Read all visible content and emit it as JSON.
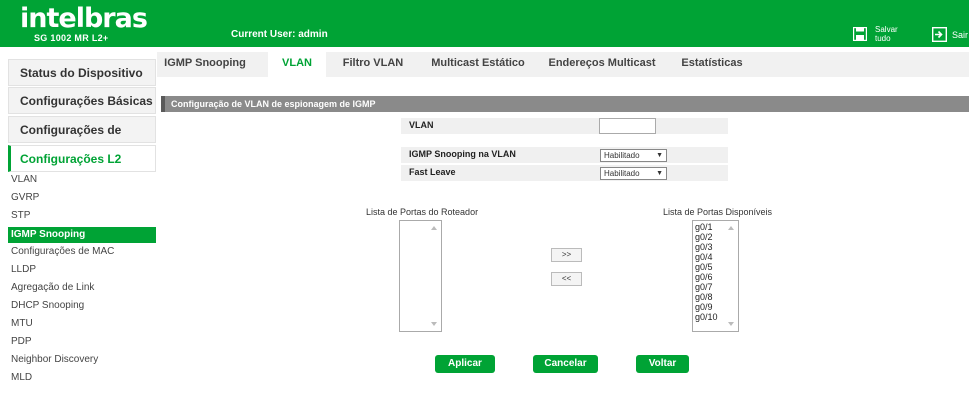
{
  "header": {
    "logo": "intelbras",
    "model": "SG 1002 MR L2+",
    "current_user": "Current User: admin",
    "save_label": "Salvar\ntudo",
    "exit_label": "Sair"
  },
  "sidebar": {
    "main_items": [
      {
        "label": "Status do Dispositivo"
      },
      {
        "label": "Configurações Básicas"
      },
      {
        "label": "Configurações de Portas"
      }
    ],
    "active_section": "Configurações L2",
    "sub_items": [
      {
        "label": "VLAN"
      },
      {
        "label": "GVRP"
      },
      {
        "label": "STP"
      },
      {
        "label": "IGMP Snooping"
      },
      {
        "label": "Configurações de MAC"
      },
      {
        "label": "LLDP"
      },
      {
        "label": "Agregação de Link"
      },
      {
        "label": "DHCP Snooping"
      },
      {
        "label": "MTU"
      },
      {
        "label": "PDP"
      },
      {
        "label": "Neighbor Discovery"
      },
      {
        "label": "MLD"
      }
    ]
  },
  "tabs": [
    {
      "label": "IGMP Snooping"
    },
    {
      "label": "VLAN"
    },
    {
      "label": "Filtro VLAN"
    },
    {
      "label": "Multicast Estático"
    },
    {
      "label": "Endereços Multicast"
    },
    {
      "label": "Estatísticas"
    }
  ],
  "section_title": "Configuração de VLAN de espionagem de IGMP",
  "form": {
    "vlan_label": "VLAN",
    "vlan_value": "",
    "snooping_label": "IGMP Snooping na VLAN",
    "snooping_value": "Habilitado",
    "fast_leave_label": "Fast Leave",
    "fast_leave_value": "Habilitado"
  },
  "router_ports": {
    "title": "Lista de Portas do Roteador",
    "items": []
  },
  "available_ports": {
    "title": "Lista de Portas Disponíveis",
    "items": [
      "g0/1",
      "g0/2",
      "g0/3",
      "g0/4",
      "g0/5",
      "g0/6",
      "g0/7",
      "g0/8",
      "g0/9",
      "g0/10"
    ]
  },
  "move_buttons": {
    "add": ">>",
    "remove": "<<"
  },
  "actions": {
    "apply": "Aplicar",
    "cancel": "Cancelar",
    "back": "Voltar"
  },
  "colors": {
    "brand_green": "#00a335",
    "section_gray": "#8a8a8a"
  }
}
